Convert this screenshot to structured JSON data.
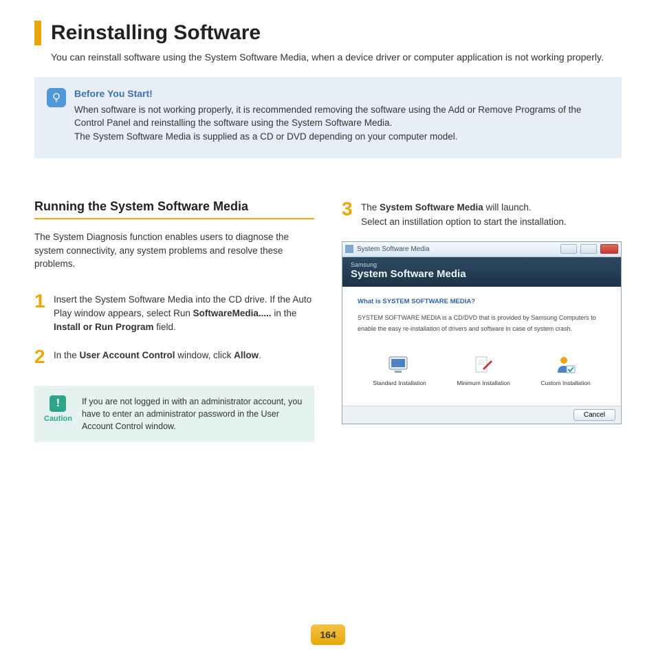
{
  "page_title": "Reinstalling Software",
  "intro": "You can reinstall software using the System Software Media, when a device driver or computer application is not working properly.",
  "info": {
    "title": "Before You Start!",
    "line1": "When software is not working properly, it is recommended removing the software using the Add or Remove Programs of the Control Panel and reinstalling the software using the System Software Media.",
    "line2": "The System Software Media is supplied as a CD or DVD depending on your computer model."
  },
  "section": {
    "heading": "Running the System Software Media",
    "desc": "The System Diagnosis function enables users to diagnose the system connectivity, any system problems and resolve these problems."
  },
  "steps": {
    "s1_a": "Insert the System Software Media into the CD drive. If the Auto Play window appears, select Run ",
    "s1_b1": "SoftwareMedia.....",
    "s1_c": " in the ",
    "s1_b2": "Install or Run Program",
    "s1_d": " field.",
    "s2_a": "In the ",
    "s2_b1": "User Account Control",
    "s2_c": " window, click ",
    "s2_b2": "Allow",
    "s2_d": ".",
    "s3_a": "The ",
    "s3_b1": "System Software Media",
    "s3_c": " will launch.",
    "s3_d": "Select an instillation option to start the installation."
  },
  "caution": {
    "label": "Caution",
    "text": "If you are not logged in with an administrator account, you have to enter an administrator password in the User Account Control window."
  },
  "window": {
    "titlebar": "System Software Media",
    "brand": "Samsung",
    "title": "System Software Media",
    "question": "What is SYSTEM SOFTWARE MEDIA?",
    "desc": "SYSTEM SOFTWARE MEDIA is a CD/DVD that is provided by Samsung Computers to enable the easy re-installation of drivers and software in case of system crash.",
    "opts": {
      "standard": "Standard Installation",
      "minimum": "Minimum Installation",
      "custom": "Custom Installation"
    },
    "cancel": "Cancel"
  },
  "page_number": "164"
}
